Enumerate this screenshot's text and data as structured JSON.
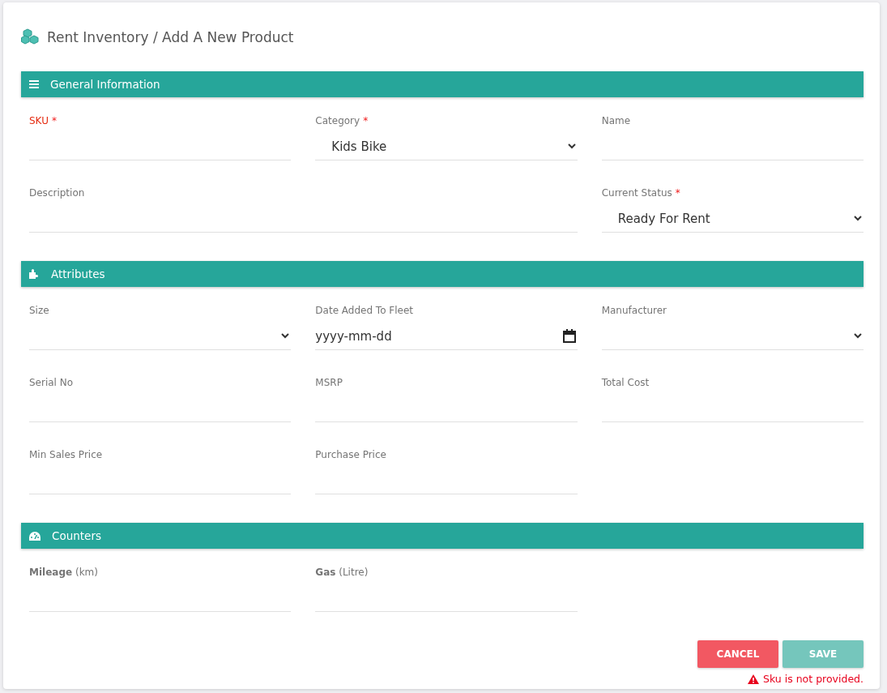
{
  "title": "Rent Inventory / Add A New Product",
  "sections": [
    {
      "title": "General Information",
      "fields": [
        {
          "label": "SKU",
          "kind": "text",
          "required": true,
          "error": true
        },
        {
          "label": "Category",
          "kind": "select",
          "required": true,
          "error": false,
          "value": "Kids Bike"
        },
        {
          "label": "Name",
          "kind": "text",
          "required": false,
          "error": false
        },
        {
          "label": "Description",
          "kind": "wide",
          "required": false,
          "error": false
        },
        {
          "label": "Current Status",
          "kind": "select",
          "required": true,
          "error": false,
          "value": "Ready For Rent"
        }
      ]
    },
    {
      "title": "Attributes",
      "fields": [
        {
          "label": "Size",
          "kind": "select",
          "required": false,
          "error": false
        },
        {
          "label": "Date Added To Fleet",
          "kind": "date",
          "required": false,
          "error": false,
          "value": "yyyy-mm-dd"
        },
        {
          "label": "Manufacturer",
          "kind": "select",
          "required": false,
          "error": false
        },
        {
          "label": "Serial No",
          "kind": "text",
          "required": false,
          "error": false
        },
        {
          "label": "MSRP",
          "kind": "text",
          "required": false,
          "error": false
        },
        {
          "label": "Total Cost",
          "kind": "text",
          "required": false,
          "error": false
        },
        {
          "label": "Min Sales Price",
          "kind": "text",
          "required": false,
          "error": false
        },
        {
          "label": "Purchase Price",
          "kind": "text",
          "required": false,
          "error": false
        }
      ]
    },
    {
      "title": "Counters",
      "fields": [
        {
          "label": "**Mileage** (km)",
          "kind": "text",
          "required": false,
          "error": false
        },
        {
          "label": "**Gas** (Litre)",
          "kind": "text",
          "required": false,
          "error": false
        }
      ]
    }
  ],
  "buttons": [
    {
      "label": "CANCEL",
      "kind": "cancel"
    },
    {
      "label": "SAVE",
      "kind": "save"
    }
  ],
  "error_message": "Sku is not provided.",
  "required_mark": "*"
}
